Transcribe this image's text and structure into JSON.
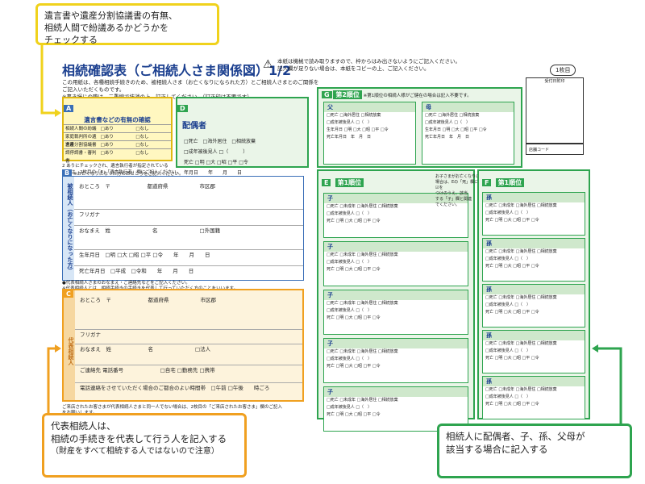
{
  "callouts": {
    "top": [
      "遺言書や遺産分割協議書の有無、",
      "相続人間で紛議あるかどうかを",
      "チェックする"
    ],
    "rep": {
      "lines": [
        "代表相続人は、",
        "相続の手続きを代表して行う人を記入する"
      ],
      "sub": "（財産をすべて相続する人ではないので注意）"
    },
    "heirs": [
      "相続人に配偶者、子、孫、父母が",
      "該当する場合に記入する"
    ]
  },
  "form": {
    "title": "相続確認表（ご相続人さま関係図）1/2",
    "warning": [
      "本紙は機械で読み取りますので、枠からはみ出さないようにご記入ください。",
      "記入欄が足りない場合は、本紙をコピーの上、ご記入ください。"
    ],
    "page": "1枚目",
    "intro": [
      "この用紙は、各種相続手続きのため、被相続人さま（お亡くなりになられた方）とご相続人さまとのご関係をご記入いただくものです。",
      "※書き損じの際は、二重線で抹消の上、訂正してください。（訂正印は不要です）"
    ],
    "A": {
      "label": "A",
      "heading": "遺言書などの有無の確認",
      "rows": [
        {
          "n": "1",
          "t": "相続人間の紛議",
          "a": "□あり",
          "b": "□なし"
        },
        {
          "n": "2",
          "t": "家庭裁判所の遺言書",
          "a": "□あり",
          "b": "□なし"
        },
        {
          "n": "3",
          "t": "遺産分割協議書",
          "a": "□あり",
          "b": "□なし"
        },
        {
          "n": "4",
          "t": "調停調書・審判書",
          "a": "□あり",
          "b": "□なし"
        }
      ],
      "note": [
        "2 ありにチェックされ、遺言執行者が指定されている",
        "場合は、2枚目の「E」「遺言執行者」欄にご記入ください。"
      ]
    },
    "D": {
      "label": "D",
      "heading": "配偶者",
      "r1": "□死亡　□海外居住　□相続放棄",
      "r2": "□成年被後見人 □（　　　）",
      "r3": "死亡 □明 □大 □昭 □平 □令",
      "r4": "年月日　　年　　月　　日"
    },
    "B": {
      "label": "B",
      "note": "※お亡くなりになった方のおところをご記入ください。",
      "side": "被相続人（お亡くなりになった方）",
      "rows": [
        "おところ　〒　　　　　　　都道府県　　　　　　市区郡",
        "フリガナ",
        "おなまえ　姓　　　　　　　　名　　　　　　　　□外国籍",
        "生年月日　□明 □大 □昭 □平 □令　　年　　月　　日",
        "死亡年月日　□平成　□令和　　年　　月　　日"
      ]
    },
    "C": {
      "label": "C",
      "note": [
        "●代表相続人さまのおなまえ・ご連絡先などをご記入ください。",
        "※代表相続人とは、相続手続きの手続きを代表して行っていただく方のことをいいます。"
      ],
      "side": "代表相続人",
      "rows": [
        "おところ　〒　　　　　　　都道府県　　　　　　市区郡",
        "フリガナ",
        "おなまえ　姓　　　　　　　名　　　　　　　　□法人",
        "ご連絡先 電話番号　　　　　　　□自宅 □勤務先 □携帯",
        "電話連絡をさせていただく場合のご都合のよい時間帯　□午前 □午後　　時ごろ"
      ]
    },
    "footer": [
      "ご来店されたお客さまが代表相続人さまと同一人でない場合は、2枚目の「ご来店されたお客さま」欄のご記入",
      "をお願いします。"
    ],
    "G": {
      "label": "G",
      "heading": "第2順位",
      "note": "※第1順位の相続人様がご健在の場合は記入不要です。",
      "father": "父",
      "mother": "母",
      "line": "□死亡 □海外居住 □相続放棄",
      "line2": "□成年被後見人 □（　）",
      "birth": "生年月日 □明 □大 □昭 □平 □令",
      "death": "死亡年月日　年　月　日"
    },
    "E": {
      "label": "E",
      "heading": "第1順位",
      "child": "子",
      "line": "□死亡 □未成年 □海外居住 □相続放棄",
      "line2": "□成年被後見人 □（　）",
      "death": "死亡 □明 □大 □昭 □平 □令"
    },
    "F": {
      "label": "F",
      "heading": "第1順位",
      "grand": "孫",
      "line": "□死亡 □未成年 □海外居住 □相続放棄",
      "line2": "□成年被後見人 □（　）",
      "death": "死亡 □明 □大 □昭 □平 □令"
    },
    "center_note": [
      "お子さまがお亡くなりの",
      "場合は、Eの「死」欄に☑を",
      "つけのうえ、該当",
      "する「子」欄と関連",
      "でください。"
    ],
    "stamp": "受付日附印",
    "code": "店舗コード"
  },
  "colors": {
    "yellow": "#f0d21c",
    "orange": "#f0a020",
    "green": "#2ea44f",
    "blue": "#1b3f8f"
  }
}
